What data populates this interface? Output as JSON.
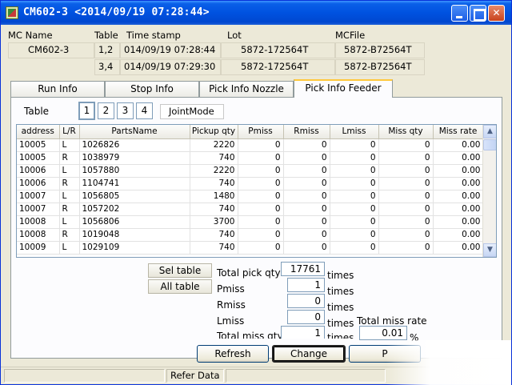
{
  "window": {
    "title": "CM602-3 <2014/09/19 07:28:44>",
    "icons": [
      "app-icon",
      "minimize-icon",
      "maximize-icon",
      "close-icon"
    ]
  },
  "info_headers": {
    "mc_name": "MC Name",
    "table": "Table",
    "time_stamp": "Time stamp",
    "lot": "Lot",
    "mcfile": "MCFile"
  },
  "info": {
    "mc_name": "CM602-3",
    "rows": [
      {
        "table": "1,2",
        "time_stamp": "014/09/19 07:28:44",
        "lot": "5872-172564T",
        "mcfile": "5872-B72564T"
      },
      {
        "table": "3,4",
        "time_stamp": "014/09/19 07:29:30",
        "lot": "5872-172564T",
        "mcfile": "5872-B72564T"
      }
    ]
  },
  "tabs": [
    {
      "label": "Run Info"
    },
    {
      "label": "Stop Info"
    },
    {
      "label": "Pick Info Nozzle"
    },
    {
      "label": "Pick Info Feeder",
      "active": true
    }
  ],
  "table_selector": {
    "label": "Table",
    "numbers": [
      "1",
      "2",
      "3",
      "4"
    ],
    "selected": "1",
    "mode": "JointMode"
  },
  "grid": {
    "columns": [
      "address",
      "L/R",
      "PartsName",
      "Pickup qty",
      "Pmiss",
      "Rmiss",
      "Lmiss",
      "Miss qty",
      "Miss rate"
    ],
    "rows": [
      [
        "10005",
        "L",
        "1026826",
        "2220",
        "0",
        "0",
        "0",
        "0",
        "0.00"
      ],
      [
        "10005",
        "R",
        "1038979",
        "740",
        "0",
        "0",
        "0",
        "0",
        "0.00"
      ],
      [
        "10006",
        "L",
        "1057880",
        "2220",
        "0",
        "0",
        "0",
        "0",
        "0.00"
      ],
      [
        "10006",
        "R",
        "1104741",
        "740",
        "0",
        "0",
        "0",
        "0",
        "0.00"
      ],
      [
        "10007",
        "L",
        "1056805",
        "1480",
        "0",
        "0",
        "0",
        "0",
        "0.00"
      ],
      [
        "10007",
        "R",
        "1057202",
        "740",
        "0",
        "0",
        "0",
        "0",
        "0.00"
      ],
      [
        "10008",
        "L",
        "1056806",
        "3700",
        "0",
        "0",
        "0",
        "0",
        "0.00"
      ],
      [
        "10008",
        "R",
        "1019048",
        "740",
        "0",
        "0",
        "0",
        "0",
        "0.00"
      ],
      [
        "10009",
        "L",
        "1029109",
        "740",
        "0",
        "0",
        "0",
        "0",
        "0.00"
      ]
    ],
    "scroll_up": "▲",
    "scroll_down": "▼"
  },
  "summary": {
    "sel_table": "Sel table",
    "all_table": "All table",
    "total_pick_qty_label": "Total pick qty",
    "total_pick_qty": "17761",
    "pmiss_label": "Pmiss",
    "pmiss": "1",
    "rmiss_label": "Rmiss",
    "rmiss": "0",
    "lmiss_label": "Lmiss",
    "lmiss": "0",
    "total_miss_qty_label": "Total miss qty",
    "total_miss_qty": "1",
    "times": "times",
    "total_miss_rate_label": "Total miss rate",
    "total_miss_rate": "0.01",
    "percent": "%"
  },
  "buttons": {
    "refresh": "Refresh",
    "change": "Change",
    "print": "P"
  },
  "status": {
    "refer_data": "Refer Data"
  },
  "colors": {
    "title_bar": "#0052e0",
    "tab_active_accent": "#ffc83c",
    "window_bg": "#ece9d8"
  }
}
